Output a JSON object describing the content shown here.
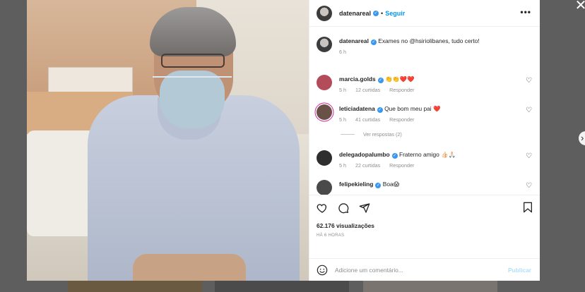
{
  "post": {
    "username": "datenareal",
    "follow_label": "Seguir",
    "caption": "Exames no @hsiriolibanes, tudo certo!",
    "caption_time": "6 h",
    "views": "62.176 visualizações",
    "posted_ago": "HÁ 6 HORAS"
  },
  "comments": [
    {
      "username": "marcia.golds",
      "text": "👏👏❤️❤️",
      "time": "5 h",
      "likes": "12 curtidas",
      "reply": "Responder",
      "avatar_color": "#b34b5a"
    },
    {
      "username": "leticiadatena",
      "text": "Que bom meu pai ❤️",
      "time": "5 h",
      "likes": "41 curtidas",
      "reply": "Responder",
      "avatar_color": "#6a5147"
    },
    {
      "username": "delegadopalumbo",
      "text": "Fraterno amigo 👍🏻🙏🏻",
      "time": "5 h",
      "likes": "22 curtidas",
      "reply": "Responder",
      "avatar_color": "#2e2e2e"
    },
    {
      "username": "felipekieling",
      "text": "Boa😱",
      "time": "",
      "likes": "",
      "reply": "",
      "avatar_color": "#4a4a4a"
    }
  ],
  "view_replies": "Ver respostas (2)",
  "comment_box": {
    "placeholder": "Adicione um comentário...",
    "publish": "Publicar"
  },
  "icons": [
    "close-icon",
    "next-arrow-icon",
    "more-icon",
    "heart-icon",
    "comment-icon",
    "share-icon",
    "save-icon",
    "emoji-icon"
  ],
  "colors": {
    "link": "#0095f6",
    "verified": "#3897f0",
    "publish_disabled": "#b2dffc"
  }
}
